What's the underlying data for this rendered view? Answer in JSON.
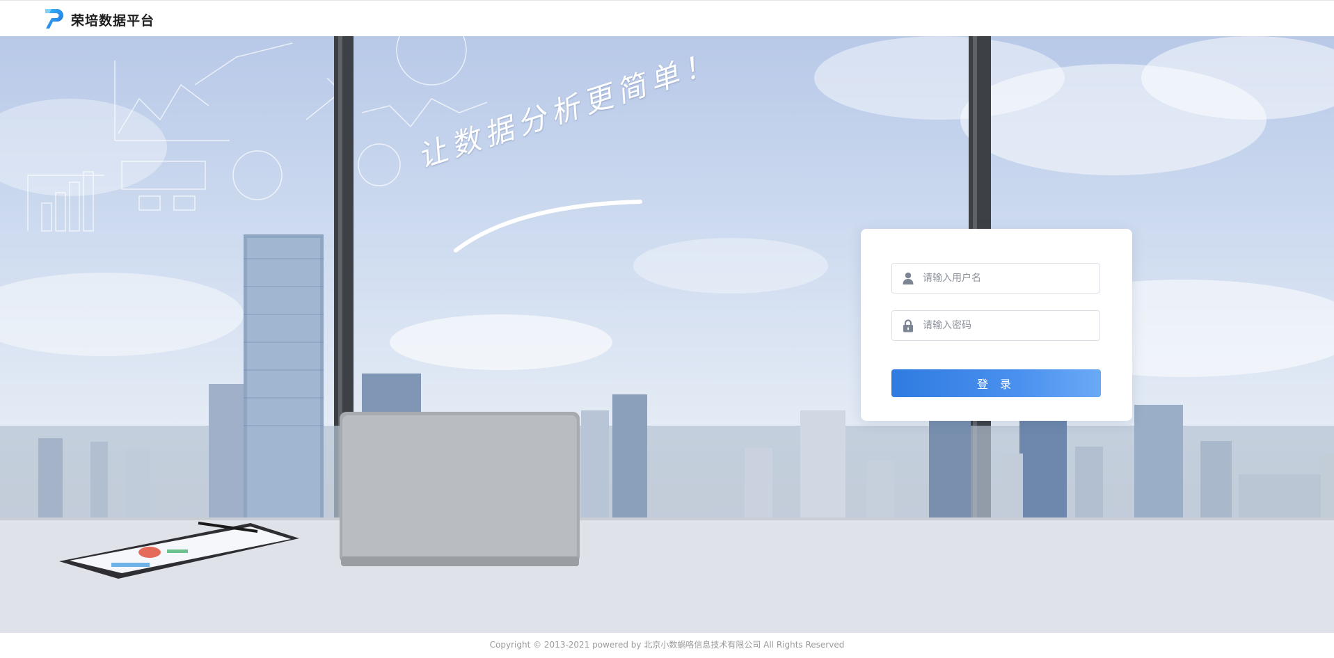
{
  "header": {
    "brand_name": "荣培数据平台",
    "logo_icon": "brand-logo-icon",
    "accent_color": "#1f8ef1"
  },
  "hero": {
    "slogan": "让数据分析更简单！"
  },
  "login": {
    "username_placeholder": "请输入用户名",
    "password_placeholder": "请输入密码",
    "username_icon": "user-icon",
    "password_icon": "lock-icon",
    "submit_label": "登 录",
    "button_color": "#3a86e8"
  },
  "footer": {
    "copyright": "Copyright © 2013-2021 powered by 北京小数蜗咯信息技术有限公司 All Rights Reserved"
  }
}
